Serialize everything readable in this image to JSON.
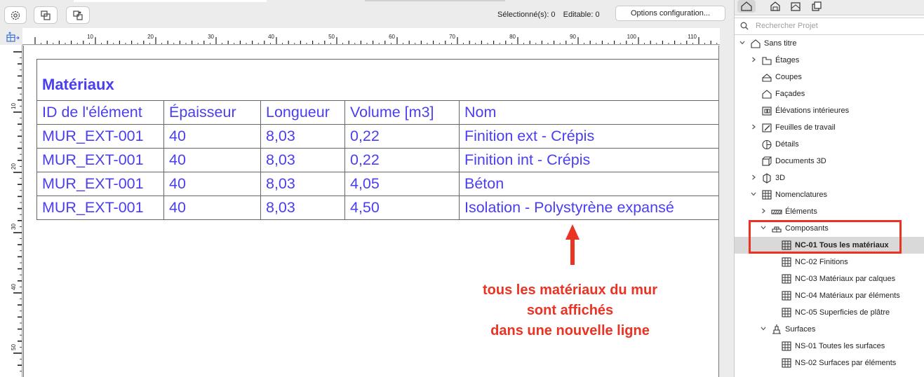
{
  "toolbar": {
    "selected_label": "Sélectionné(s): 0",
    "editable_label": "Editable: 0",
    "options_button": "Options configuration..."
  },
  "ruler": {
    "h_labels": [
      "10",
      "20",
      "30",
      "40",
      "50",
      "60",
      "70",
      "80",
      "90",
      "100",
      "110"
    ],
    "v_labels": [
      "10",
      "20",
      "30",
      "40",
      "50"
    ]
  },
  "schedule": {
    "title": "Matériaux",
    "headers": [
      "ID de l'élément",
      "Épaisseur",
      "Longueur",
      "Volume [m3]",
      "Nom"
    ],
    "rows": [
      [
        "MUR_EXT-001",
        "40",
        "8,03",
        "0,22",
        "Finition ext - Crépis"
      ],
      [
        "MUR_EXT-001",
        "40",
        "8,03",
        "0,22",
        "Finition int - Crépis"
      ],
      [
        "MUR_EXT-001",
        "40",
        "8,03",
        "4,05",
        "Béton"
      ],
      [
        "MUR_EXT-001",
        "40",
        "8,03",
        "4,50",
        "Isolation - Polystyrène expansé"
      ]
    ]
  },
  "annotation": {
    "line1": "tous les matériaux du mur",
    "line2": "sont affichés",
    "line3": "dans une nouvelle ligne",
    "color": "#ea3323"
  },
  "panel": {
    "search_placeholder": "Rechercher Projet",
    "tree": [
      {
        "label": "Sans titre",
        "level": 0,
        "chevron": "down",
        "icon": "house-icon"
      },
      {
        "label": "Étages",
        "level": 1,
        "chevron": "right",
        "icon": "floors-icon"
      },
      {
        "label": "Coupes",
        "level": 1,
        "chevron": "",
        "icon": "section-icon"
      },
      {
        "label": "Façades",
        "level": 1,
        "chevron": "",
        "icon": "elevation-icon"
      },
      {
        "label": "Élévations intérieures",
        "level": 1,
        "chevron": "",
        "icon": "interior-elevation-icon"
      },
      {
        "label": "Feuilles de travail",
        "level": 1,
        "chevron": "right",
        "icon": "worksheet-icon"
      },
      {
        "label": "Détails",
        "level": 1,
        "chevron": "",
        "icon": "detail-icon"
      },
      {
        "label": "Documents 3D",
        "level": 1,
        "chevron": "",
        "icon": "document-3d-icon"
      },
      {
        "label": "3D",
        "level": 1,
        "chevron": "right",
        "icon": "cube-icon"
      },
      {
        "label": "Nomenclatures",
        "level": 1,
        "chevron": "down",
        "icon": "table-icon"
      },
      {
        "label": "Éléments",
        "level": 2,
        "chevron": "right",
        "icon": "elements-icon"
      },
      {
        "label": "Composants",
        "level": 2,
        "chevron": "down",
        "icon": "components-icon"
      },
      {
        "label": "NC-01 Tous les matériaux",
        "level": 3,
        "chevron": "",
        "icon": "table-icon",
        "selected": true
      },
      {
        "label": "NC-02 Finitions",
        "level": 3,
        "chevron": "",
        "icon": "table-icon"
      },
      {
        "label": "NC-03 Matériaux par calques",
        "level": 3,
        "chevron": "",
        "icon": "table-icon"
      },
      {
        "label": "NC-04 Matériaux par éléments",
        "level": 3,
        "chevron": "",
        "icon": "table-icon"
      },
      {
        "label": "NC-05 Superficies de plâtre",
        "level": 3,
        "chevron": "",
        "icon": "table-icon"
      },
      {
        "label": "Surfaces",
        "level": 2,
        "chevron": "down",
        "icon": "surfaces-icon"
      },
      {
        "label": "NS-01 Toutes les surfaces",
        "level": 3,
        "chevron": "",
        "icon": "table-icon"
      },
      {
        "label": "NS-02 Surfaces par éléments",
        "level": 3,
        "chevron": "",
        "icon": "table-icon"
      }
    ]
  }
}
